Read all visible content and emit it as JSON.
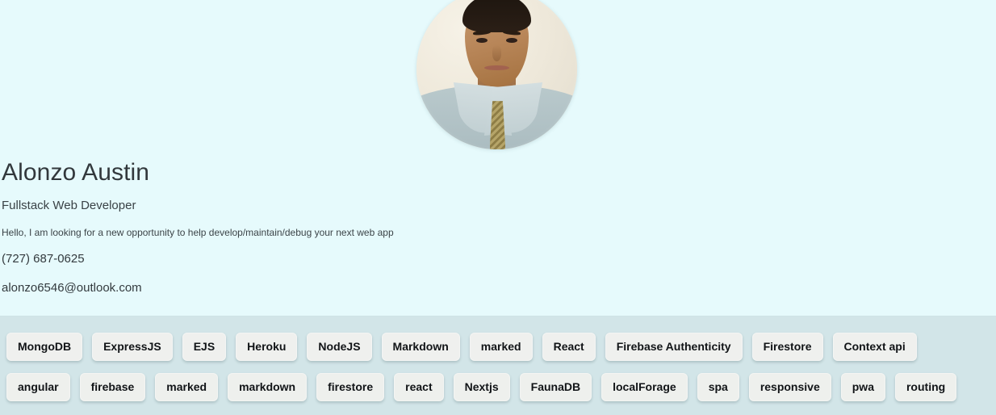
{
  "theme": {
    "page_background": "#e6fafc",
    "tags_panel_background": "#d2e5e8",
    "tag_chip_background": "#eff0ee",
    "text_color": "#333a3e"
  },
  "profile": {
    "avatar_alt": "profile-photo",
    "name": "Alonzo Austin",
    "title": "Fullstack Web Developer",
    "bio": "Hello, I am looking for a new opportunity to help develop/maintain/debug your next web app",
    "phone": "(727) 687-0625",
    "email": "alonzo6546@outlook.com"
  },
  "tags": {
    "row_1": [
      "MongoDB",
      "ExpressJS",
      "EJS",
      "Heroku",
      "NodeJS",
      "Markdown",
      "marked",
      "React",
      "Firebase Authenticity",
      "Firestore",
      "Context api"
    ],
    "row_2": [
      "angular",
      "firebase",
      "marked",
      "markdown",
      "firestore",
      "react",
      "Nextjs",
      "FaunaDB",
      "localForage",
      "spa",
      "responsive",
      "pwa",
      "routing"
    ]
  }
}
